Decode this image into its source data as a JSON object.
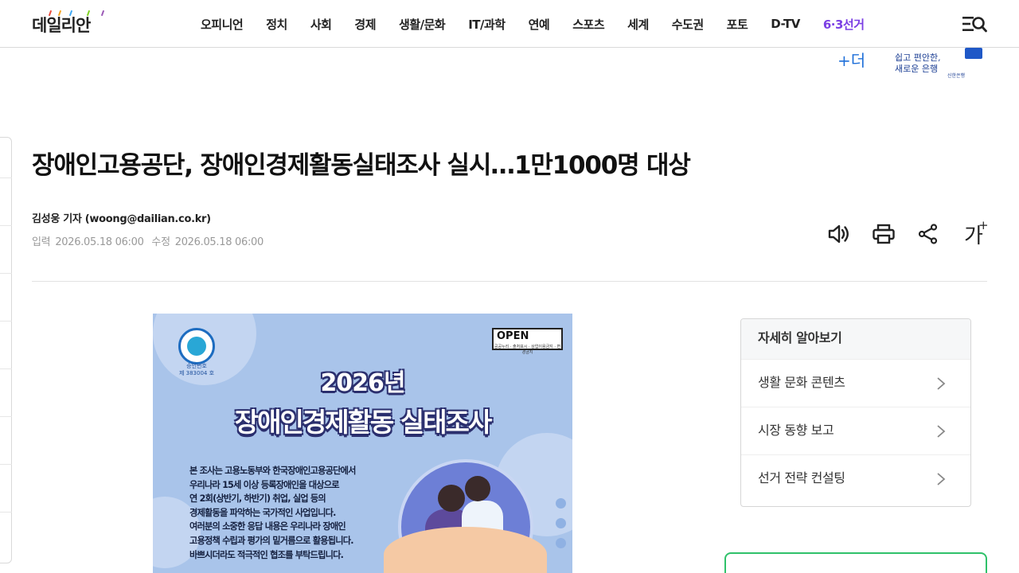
{
  "header": {
    "logo": "데일리안",
    "nav": [
      "오피니언",
      "정치",
      "사회",
      "경제",
      "생활/문화",
      "IT/과학",
      "연예",
      "스포츠",
      "세계",
      "수도권",
      "포토",
      "D-TV",
      "6·3선거"
    ],
    "accent_color": "#7b3fe4",
    "menu_search_icon": "menu-search-icon"
  },
  "ad": {
    "plus": "+더",
    "line1": "쉽고 편안한,",
    "line2": "새로운 은행",
    "bank": "신한은행"
  },
  "article": {
    "title": "장애인고용공단, 장애인경제활동실태조사 실시…1만1000명 대상",
    "byline": "김성웅 기자 (woong@dailian.co.kr)",
    "published_label": "입력",
    "published": "2026.05.18 06:00",
    "modified_label": "수정",
    "modified": "2026.05.18 06:00",
    "font_size_label": "가",
    "tools": [
      "speaker-icon",
      "print-icon",
      "share-icon",
      "font-size-icon"
    ]
  },
  "image": {
    "open_label": "OPEN",
    "open_sub": "공공누리 · 출처표시 · 상업이용금지 · 변경금지",
    "seal_caption_1": "승인번호",
    "seal_caption_2": "제 383004 호",
    "year": "2026년",
    "headline": "장애인경제활동 실태조사",
    "body": [
      "본 조사는 고용노동부와 한국장애인고용공단에서",
      "우리나라 15세 이상 등록장애인을 대상으로",
      "연 2회(상반기, 하반기) 취업, 실업 등의",
      "경제활동을 파악하는 국가적인 사업입니다.",
      "여러분의 소중한 응답 내용은 우리나라 장애인",
      "고용정책 수립과 평가의 밑거름으로 활용됩니다.",
      "바쁘시더라도 적극적인 협조를 부탁드립니다."
    ]
  },
  "more": {
    "heading": "자세히 알아보기",
    "items": [
      "생활 문화 콘텐츠",
      "시장 동향 보고",
      "선거 전략 컨설팅"
    ]
  }
}
